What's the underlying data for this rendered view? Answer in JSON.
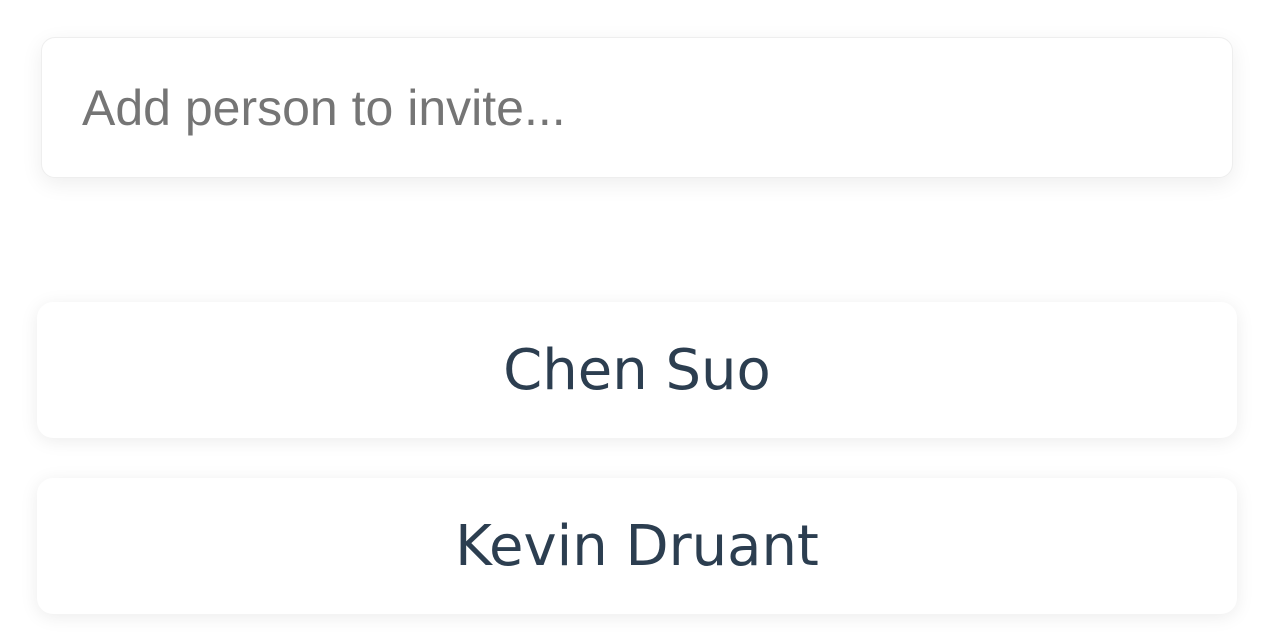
{
  "invite": {
    "search_placeholder": "Add person to invite...",
    "search_value": ""
  },
  "people": [
    {
      "name": "Chen Suo"
    },
    {
      "name": "Kevin Druant"
    }
  ],
  "colors": {
    "name_text": "#2c3e50",
    "placeholder_text": "#757575",
    "card_bg": "#ffffff"
  }
}
